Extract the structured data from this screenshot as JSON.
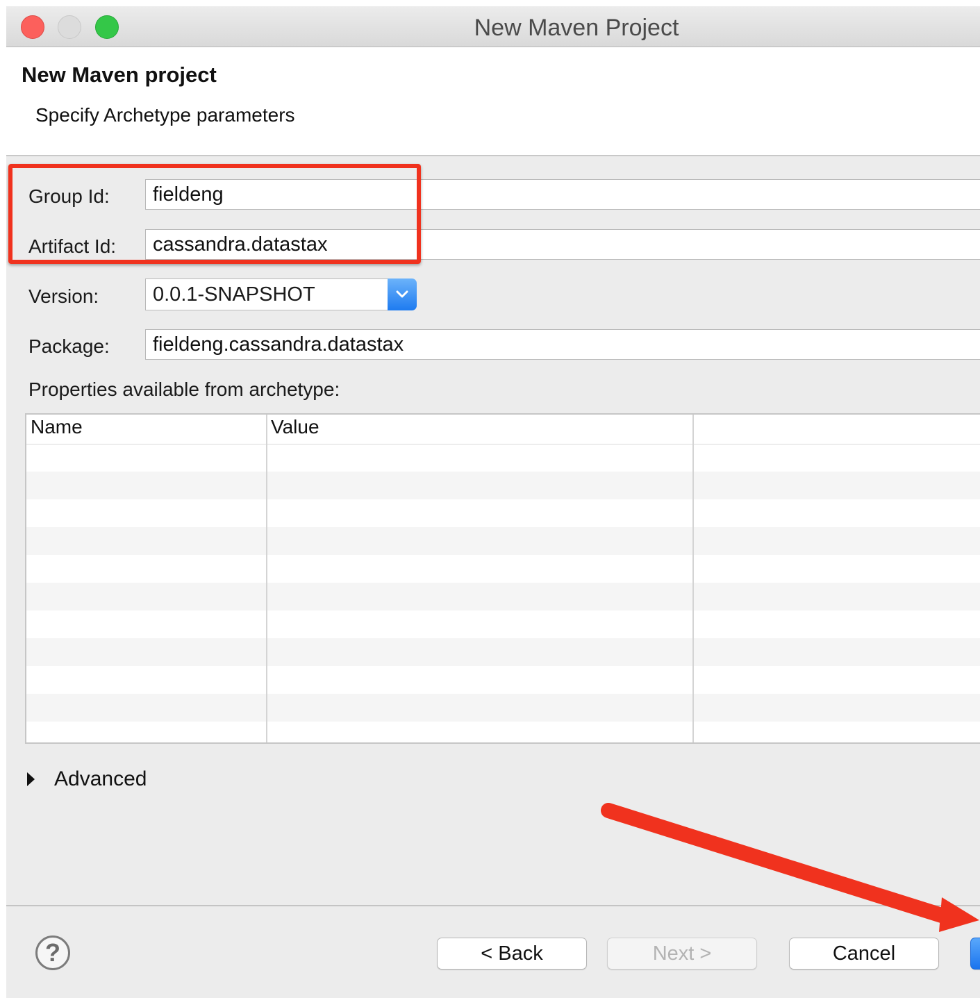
{
  "window": {
    "title": "New Maven Project"
  },
  "header": {
    "title": "New Maven project",
    "subtitle": "Specify Archetype parameters"
  },
  "form": {
    "group_id_label": "Group Id:",
    "group_id_value": "fieldeng",
    "artifact_id_label": "Artifact Id:",
    "artifact_id_value": "cassandra.datastax",
    "version_label": "Version:",
    "version_value": "0.0.1-SNAPSHOT",
    "package_label": "Package:",
    "package_value": "fieldeng.cassandra.datastax",
    "properties_label": "Properties available from archetype:"
  },
  "table": {
    "columns": [
      "Name",
      "Value"
    ]
  },
  "advanced": {
    "label": "Advanced"
  },
  "buttons": {
    "back": "< Back",
    "next": "Next >",
    "cancel": "Cancel"
  },
  "colors": {
    "highlight": "#f0321e",
    "accent": "#1e7bf0"
  }
}
